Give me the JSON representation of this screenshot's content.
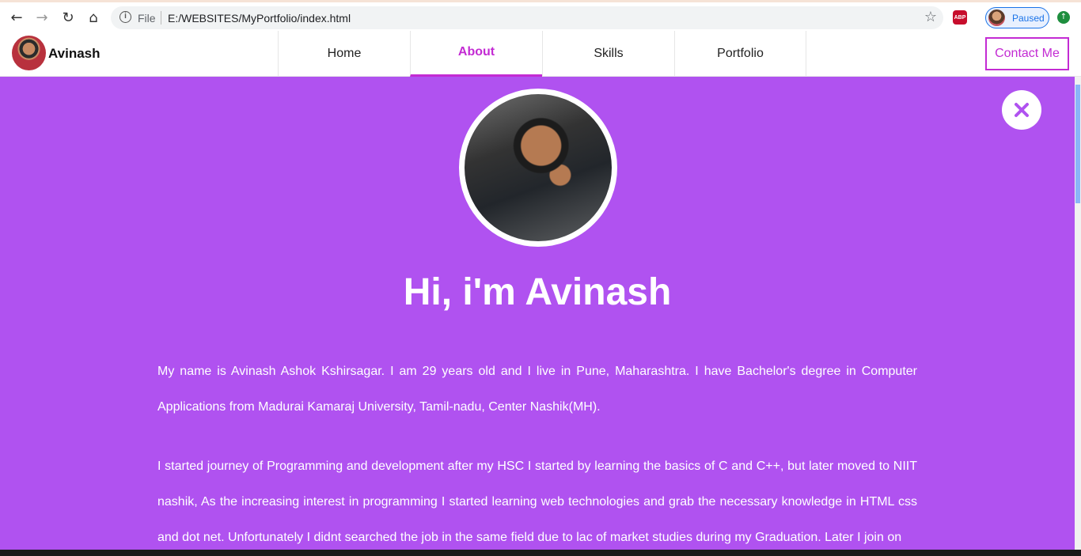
{
  "browser": {
    "back_icon": "arrow-left-icon",
    "forward_icon": "arrow-right-icon",
    "reload_icon": "reload-icon",
    "home_icon": "home-icon",
    "address_scheme": "File",
    "address_url": "E:/WEBSITES/MyPortfolio/index.html",
    "bookmark_icon": "star-icon",
    "adblock_label": "ABP",
    "profile_status": "Paused"
  },
  "navbar": {
    "brand_name": "Avinash",
    "tabs": [
      {
        "label": "Home",
        "active": false
      },
      {
        "label": "About",
        "active": true
      },
      {
        "label": "Skills",
        "active": false
      },
      {
        "label": "Portfolio",
        "active": false
      }
    ],
    "contact_label": "Contact Me"
  },
  "about": {
    "headline": "Hi, i'm Avinash",
    "paragraphs": [
      "My name is Avinash Ashok Kshirsagar. I am 29 years old and I live in Pune, Maharashtra. I have Bachelor's degree in Computer Applications from Madurai Kamaraj University, Tamil-nadu, Center Nashik(MH).",
      "I started journey of Programming and development after my HSC I started by learning the basics of C and C++, but later moved to NIIT nashik, As the increasing interest in programming I started learning web technologies and grab the necessary knowledge in HTML css and dot net. Unfortunately I didnt searched the job in the same field due to lac of market studies during my Graduation. Later I join on"
    ]
  },
  "colors": {
    "accent": "#c32bd3",
    "background": "#b052f0",
    "close_icon": "#b052f0"
  }
}
